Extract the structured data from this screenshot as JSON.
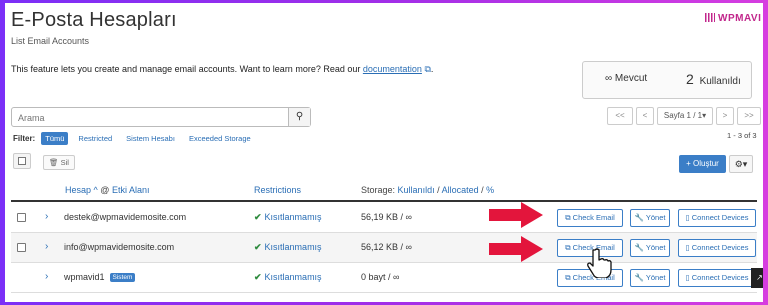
{
  "page": {
    "title": "E-Posta Hesapları",
    "subtitle": "List Email Accounts",
    "brand": "WPMAVI",
    "intro_text": "This feature lets you create and manage email accounts. Want to learn more? Read our",
    "intro_link": "documentation",
    "intro_end": "."
  },
  "stats": {
    "unlimited_symbol": "∞",
    "unlimited_label": "Mevcut",
    "used_count": "2",
    "used_label": "Kullanıldı"
  },
  "search": {
    "placeholder": "Arama"
  },
  "filter": {
    "label": "Filter:",
    "options": [
      "Tümü",
      "Restricted",
      "Sistem Hesabı",
      "Exceeded Storage"
    ],
    "active": "Tümü"
  },
  "pagination": {
    "first": "<<",
    "prev": "<",
    "page_label": "Sayfa 1 / 1",
    "next": ">",
    "last": ">>",
    "range": "1 - 3 of 3"
  },
  "toolbar": {
    "delete_label": "Sil",
    "create_label": "Oluştur"
  },
  "table": {
    "headers": {
      "account": "Hesap",
      "domain_sep": "@",
      "domain": "Etki Alanı",
      "restrictions": "Restrictions",
      "storage_prefix": "Storage:",
      "storage_used": "Kullanıldı",
      "storage_allocated": "Allocated",
      "storage_pct": "%"
    },
    "rows": [
      {
        "account": "destek@wpmavidemosite.com",
        "badge": "",
        "restriction": "Kısıtlanmamış",
        "storage": "56,19 KB / ∞",
        "has_checkbox": true
      },
      {
        "account": "info@wpmavidemosite.com",
        "badge": "",
        "restriction": "Kısıtlanmamış",
        "storage": "56,12 KB / ∞",
        "has_checkbox": true
      },
      {
        "account": "wpmavid1",
        "badge": "Sistem",
        "restriction": "Kısıtlanmamış",
        "storage": "0 bayt / ∞",
        "has_checkbox": false
      }
    ],
    "actions": {
      "check_email": "Check Email",
      "manage": "Yönet",
      "connect": "Connect Devices"
    }
  },
  "colors": {
    "accent": "#3b7ec7",
    "link": "#2a6eb5",
    "arrow": "#e3153c",
    "brand": "#c2278c",
    "success": "#2e8b3e"
  }
}
